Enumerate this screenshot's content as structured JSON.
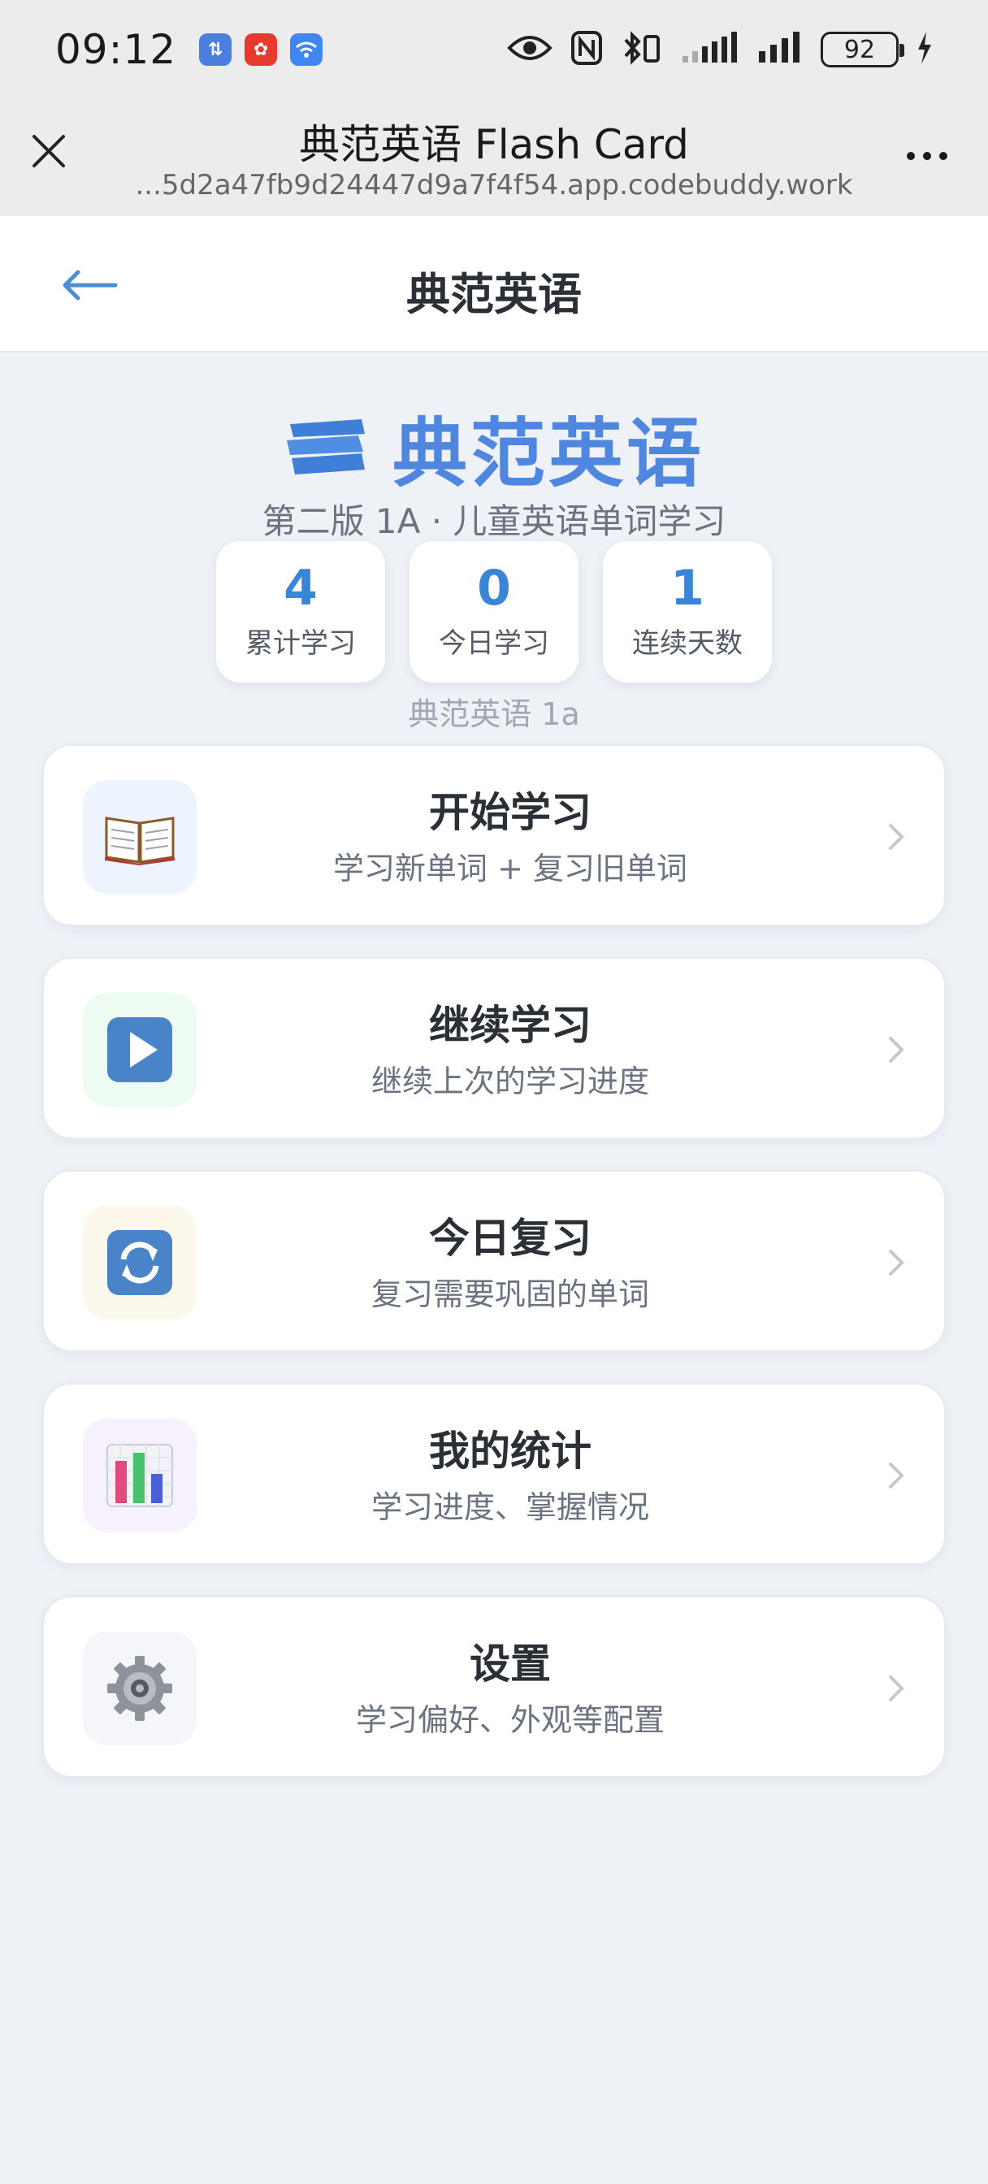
{
  "status_bar": {
    "time": "09:12",
    "battery": "92",
    "app_icons": [
      "data-transfer-icon",
      "app-notification-icon",
      "wifi-share-icon"
    ]
  },
  "browser": {
    "title": "典范英语 Flash Card",
    "url": "...5d2a47fb9d24447d9a7f4f54.app.codebuddy.work"
  },
  "app_header": {
    "title": "典范英语"
  },
  "hero": {
    "title": "典范英语",
    "subtitle": "第二版 1A · 儿童英语单词学习",
    "icon": "stacked-books-icon",
    "accent_color": "#4f86e0"
  },
  "stats": [
    {
      "value": "4",
      "label": "累计学习"
    },
    {
      "value": "0",
      "label": "今日学习"
    },
    {
      "value": "1",
      "label": "连续天数"
    }
  ],
  "stats_caption": "典范英语 1a",
  "menu": [
    {
      "title": "开始学习",
      "desc": "学习新单词 + 复习旧单词",
      "icon": "open-book-icon",
      "icon_bg": "#edf4fd"
    },
    {
      "title": "继续学习",
      "desc": "继续上次的学习进度",
      "icon": "play-icon",
      "icon_bg": "#eefbf2"
    },
    {
      "title": "今日复习",
      "desc": "复习需要巩固的单词",
      "icon": "refresh-icon",
      "icon_bg": "#fdf8ec"
    },
    {
      "title": "我的统计",
      "desc": "学习进度、掌握情况",
      "icon": "bar-chart-icon",
      "icon_bg": "#f7f1fd"
    },
    {
      "title": "设置",
      "desc": "学习偏好、外观等配置",
      "icon": "gear-icon",
      "icon_bg": "#f4f6f9"
    }
  ]
}
